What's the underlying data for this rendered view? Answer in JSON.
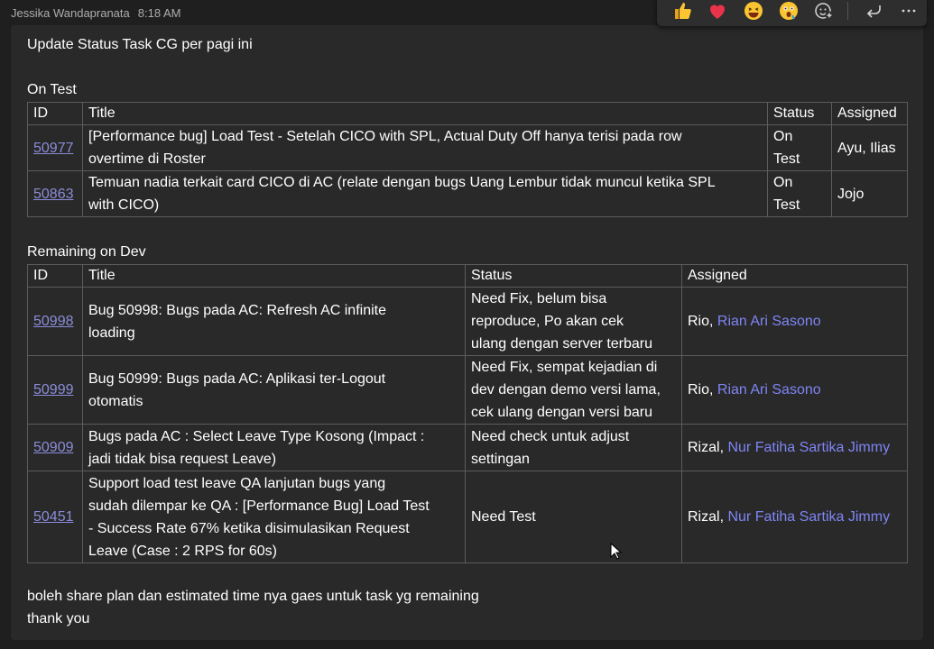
{
  "header": {
    "sender": "Jessika Wandapranata",
    "time": "8:18 AM"
  },
  "reactions": [
    "like-icon",
    "heart-icon",
    "laugh-icon",
    "surprised-icon",
    "add-reaction-icon",
    "reply-icon",
    "more-options-icon"
  ],
  "message": {
    "greeting": "Update Status Task CG per pagi ini",
    "on_test": {
      "heading": "On Test",
      "columns": [
        "ID",
        "Title",
        "Status",
        "Assigned"
      ],
      "rows": [
        {
          "id": "50977",
          "title_lines": [
            "[Performance bug] Load Test - Setelah CICO with SPL, Actual Duty Off hanya terisi pada row",
            "overtime di Roster"
          ],
          "status_lines": [
            "On",
            "Test"
          ],
          "assigned": "Ayu, Ilias"
        },
        {
          "id": "50863",
          "title_lines": [
            "Temuan nadia terkait card CICO di AC (relate dengan bugs Uang Lembur tidak muncul ketika SPL",
            "with CICO)"
          ],
          "status_lines": [
            "On",
            "Test"
          ],
          "assigned": "Jojo"
        }
      ]
    },
    "remaining": {
      "heading": "Remaining on Dev",
      "columns": [
        "ID",
        "Title",
        "Status",
        "Assigned"
      ],
      "rows": [
        {
          "id": "50998",
          "title_lines": [
            "Bug 50998: Bugs pada AC: Refresh AC infinite",
            "loading"
          ],
          "status_lines": [
            "Need Fix, belum bisa",
            "reproduce, Po akan cek",
            "ulang dengan server terbaru"
          ],
          "assigned_name": "Rio,",
          "assigned_mention": "Rian Ari Sasono"
        },
        {
          "id": "50999",
          "title_lines": [
            "Bug 50999: Bugs pada AC: Aplikasi ter-Logout",
            "otomatis"
          ],
          "status_lines": [
            "Need Fix, sempat kejadian di",
            "dev dengan demo versi lama,",
            "cek ulang dengan versi baru"
          ],
          "assigned_name": "Rio,",
          "assigned_mention": "Rian Ari Sasono"
        },
        {
          "id": "50909",
          "title_lines": [
            "Bugs pada AC : Select Leave Type Kosong (Impact :",
            "jadi tidak bisa request Leave)"
          ],
          "status_lines": [
            "Need check untuk adjust",
            "settingan"
          ],
          "assigned_name": "Rizal,",
          "assigned_mention": "Nur Fatiha Sartika Jimmy"
        },
        {
          "id": "50451",
          "title_lines": [
            "Support load test leave QA lanjutan bugs yang",
            "sudah dilempar ke QA : [Performance Bug] Load Test",
            "- Success Rate 67% ketika disimulasikan Request",
            "Leave (Case : 2 RPS for 60s)"
          ],
          "status_lines": [
            "Need Test"
          ],
          "assigned_name": "Rizal,",
          "assigned_mention": "Nur Fatiha Sartika Jimmy"
        }
      ]
    },
    "closing_1": "boleh share plan dan estimated time nya gaes untuk task yg remaining",
    "closing_2": "thank you"
  }
}
